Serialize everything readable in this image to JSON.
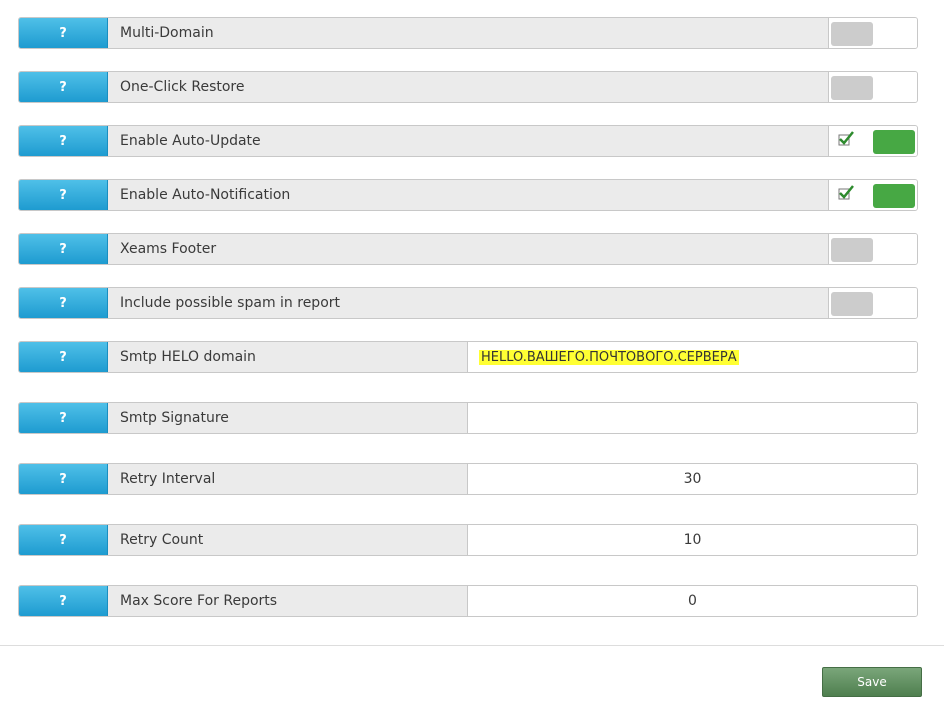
{
  "help_label": "?",
  "settings": {
    "multi_domain": {
      "label": "Multi-Domain",
      "enabled": false
    },
    "one_click_restore": {
      "label": "One-Click Restore",
      "enabled": false
    },
    "auto_update": {
      "label": "Enable Auto-Update",
      "enabled": true
    },
    "auto_notification": {
      "label": "Enable Auto-Notification",
      "enabled": true
    },
    "xeams_footer": {
      "label": "Xeams Footer",
      "enabled": false
    },
    "include_spam": {
      "label": "Include possible spam in report",
      "enabled": false
    },
    "smtp_helo": {
      "label": "Smtp HELO domain",
      "value": "HELLO.ВАШЕГО.ПОЧТОВОГО.СЕРВЕРА"
    },
    "smtp_signature": {
      "label": "Smtp Signature",
      "value": ""
    },
    "retry_interval": {
      "label": "Retry Interval",
      "value": "30"
    },
    "retry_count": {
      "label": "Retry Count",
      "value": "10"
    },
    "max_score": {
      "label": "Max Score For Reports",
      "value": "0"
    }
  },
  "save_label": "Save",
  "colors": {
    "help_button": "#1e9bd0",
    "toggle_on": "#47a844",
    "toggle_off": "#cccccc",
    "highlight": "#ffff33",
    "save_button": "#4f7f4f"
  },
  "icons": {
    "checked": "checkmark-icon"
  }
}
